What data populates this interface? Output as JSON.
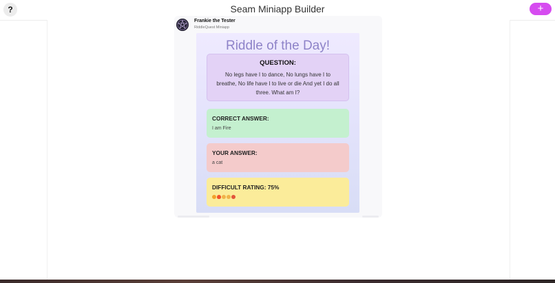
{
  "header": {
    "help_label": "?",
    "title": "Seam Miniapp Builder",
    "add_label": "+"
  },
  "post": {
    "author_name": "Frankie the Tester",
    "app_name": "RiddleQuest Miniapp"
  },
  "riddle": {
    "title": "Riddle of the Day!",
    "question_label": "QUESTION:",
    "question_text": "No legs have I to dance, No lungs have I to breathe, No life have I to live or die And yet I do all three. What am I?",
    "correct_label": "CORRECT ANSWER:",
    "correct_value": "I am Fire",
    "your_label": "YOUR ANSWER:",
    "your_value": "a cat",
    "difficulty_label": "DIFFICULT RATING: 75%",
    "difficulty_icons": [
      "emoji-face-icon",
      "fire-icon",
      "muscle-icon",
      "muscle-icon",
      "emoji-icon"
    ]
  },
  "colors": {
    "accent": "#d64cf0",
    "title_purple": "#8e83c8",
    "question_bg": "#e3d2f6",
    "correct_bg": "#c4f0cf",
    "wrong_bg": "#f4cbcb",
    "rating_bg": "#fbec9a"
  }
}
